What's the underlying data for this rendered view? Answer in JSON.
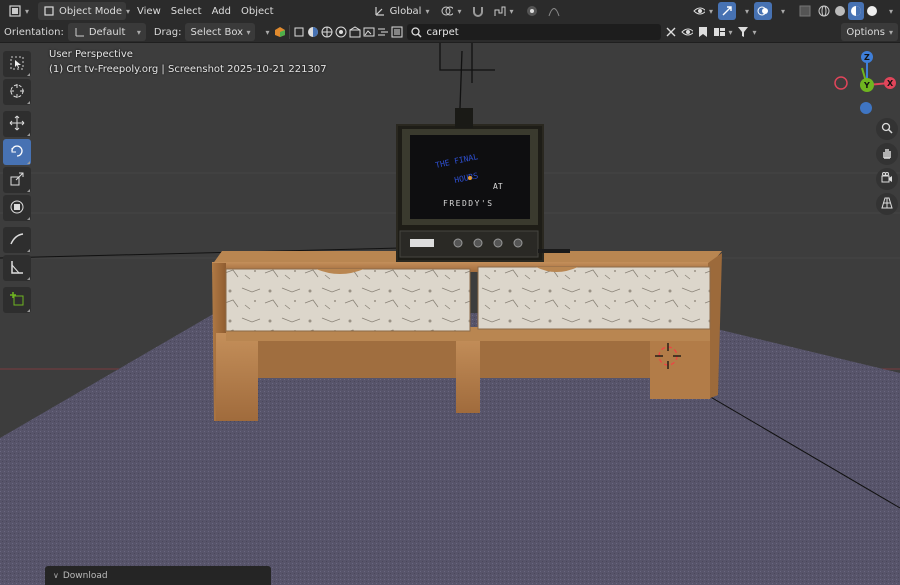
{
  "header": {
    "editor_type_icon": "grid-icon",
    "mode": "Object Mode",
    "menus": [
      "View",
      "Select",
      "Add",
      "Object"
    ],
    "transform_orientation": "Global",
    "icons": {
      "pivot": "pivot-icon",
      "snap": "magnet-icon",
      "proportional": "proportional-edit-icon",
      "visibility": "eye-icon",
      "gizmo": "gizmo-icon",
      "overlay": "overlay-icon",
      "xray": "xray-icon",
      "shading": [
        "wireframe-icon",
        "solid-icon",
        "material-icon",
        "rendered-icon"
      ]
    }
  },
  "tool_settings": {
    "orientation_label": "Orientation:",
    "orientation_value": "Default",
    "drag_label": "Drag:",
    "drag_value": "Select Box",
    "search_value": "carpet",
    "options_label": "Options"
  },
  "viewport": {
    "view_name": "User Perspective",
    "object_info": "(1) Crt tv-Freepoly.org | Screenshot 2025-10-21 221307",
    "tv_screen_lines": [
      "THE FINAL",
      "HOURS",
      "AT",
      "FREDDY'S"
    ],
    "gizmo_axes": [
      "Z",
      "Y",
      "X"
    ],
    "colors": {
      "x_axis": "#e0455a",
      "y_axis": "#6fb520",
      "z_axis": "#3f7fd9",
      "active_tool": "#4772b3",
      "floor": "#5a5769",
      "grid_bg": "#3d3d3d"
    }
  },
  "toolbar": {
    "tools": [
      "select-box-icon",
      "cursor-icon",
      "move-icon",
      "rotate-icon",
      "scale-icon",
      "transform-icon",
      "annotate-icon",
      "measure-icon",
      "add-cube-icon"
    ],
    "active_tool": "rotate-icon"
  },
  "nav_buttons": [
    "zoom-icon",
    "hand-pan-icon",
    "camera-icon",
    "perspective-grid-icon"
  ],
  "last_operation_panel": {
    "label": "Download"
  }
}
